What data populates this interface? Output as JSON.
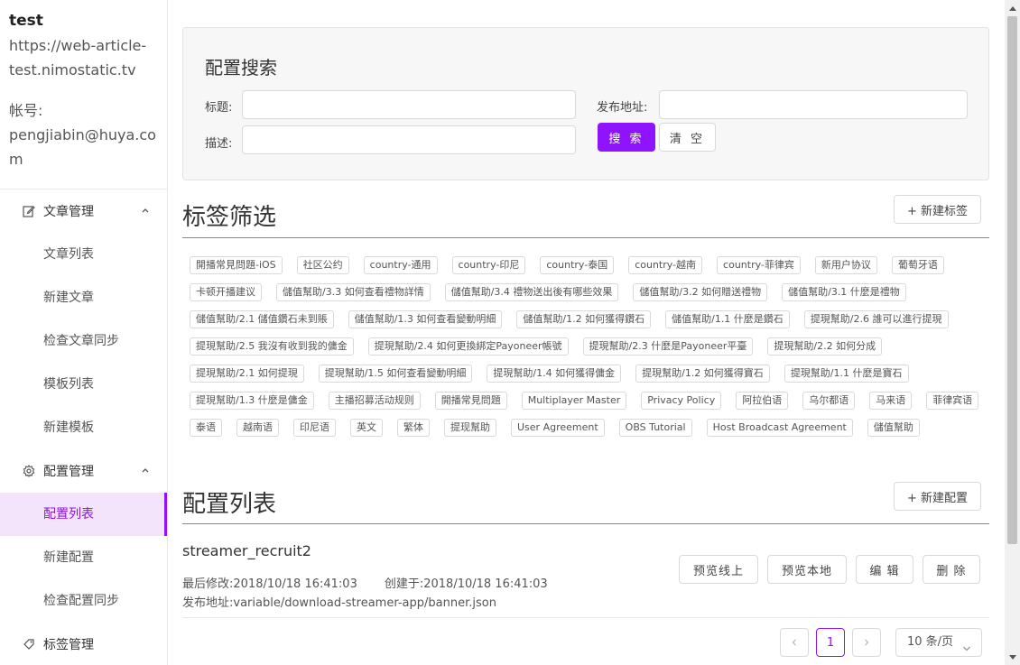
{
  "user": {
    "name": "test",
    "url_line1": "https://web-article-",
    "url_line2": "test.nimostatic.tv",
    "account_label": "帐号:",
    "email_line1": "pengjiabin@huya.co",
    "email_line2": "m"
  },
  "sidebar": {
    "groups": [
      {
        "label": "文章管理",
        "icon": "edit-icon",
        "items": [
          "文章列表",
          "新建文章",
          "检查文章同步",
          "模板列表",
          "新建模板"
        ]
      },
      {
        "label": "配置管理",
        "icon": "gear-icon",
        "items": [
          "配置列表",
          "新建配置",
          "检查配置同步"
        ]
      },
      {
        "label": "标签管理",
        "icon": "tag-icon",
        "items": []
      }
    ],
    "active_item": "配置列表"
  },
  "search": {
    "title": "配置搜索",
    "title_label": "标题:",
    "title_value": "",
    "desc_label": "描述:",
    "desc_value": "",
    "addr_label": "发布地址:",
    "addr_value": "",
    "search_button": "搜 索",
    "clear_button": "清 空"
  },
  "tags_section": {
    "title": "标签筛选",
    "new_button": "+ 新建标签",
    "tags": [
      "開播常見問題-iOS",
      "社区公约",
      "country-通用",
      "country-印尼",
      "country-泰国",
      "country-越南",
      "country-菲律宾",
      "新用户协议",
      "葡萄牙语",
      "卡顿开播建议",
      "儲值幫助/3.3 如何查看禮物詳情",
      "儲值幫助/3.4 禮物送出後有哪些效果",
      "儲值幫助/3.2 如何贈送禮物",
      "儲值幫助/3.1 什麼是禮物",
      "儲值幫助/2.1 儲值鑽石未到賬",
      "儲值幫助/1.3 如何查看變動明細",
      "儲值幫助/1.2 如何獲得鑽石",
      "儲值幫助/1.1 什麼是鑽石",
      "提現幫助/2.6 誰可以進行提現",
      "提現幫助/2.5 我沒有收到我的傭金",
      "提現幫助/2.4 如何更換綁定Payoneer帳號",
      "提現幫助/2.3 什麼是Payoneer平臺",
      "提現幫助/2.2 如何分成",
      "提現幫助/2.1 如何提現",
      "提現幫助/1.5 如何查看變動明細",
      "提現幫助/1.4 如何獲得傭金",
      "提現幫助/1.2 如何獲得寶石",
      "提現幫助/1.1 什麼是寶石",
      "提現幫助/1.3 什麼是傭金",
      "主播招募活动规则",
      "開播常見問題",
      "Multiplayer Master",
      "Privacy Policy",
      "阿拉伯语",
      "乌尔都语",
      "马来语",
      "菲律宾语",
      "泰语",
      "越南语",
      "印尼语",
      "英文",
      "繁体",
      "提现幫助",
      "User Agreement",
      "OBS Tutorial",
      "Host Broadcast Agreement",
      "儲值幫助"
    ]
  },
  "config_section": {
    "title": "配置列表",
    "new_button": "+ 新建配置",
    "items": [
      {
        "name": "streamer_recruit2",
        "modified_label": "最后修改:",
        "modified": "2018/10/18 16:41:03",
        "created_label": "创建于:",
        "created": "2018/10/18 16:41:03",
        "addr_label": "发布地址:",
        "addr": "variable/download-streamer-app/banner.json",
        "actions": [
          "预览线上",
          "预览本地",
          "编 辑",
          "删 除"
        ]
      }
    ]
  },
  "pagination": {
    "current": "1",
    "page_size": "10 条/页"
  },
  "colors": {
    "accent": "#9013fe",
    "active_bg": "#f3e3fb"
  }
}
